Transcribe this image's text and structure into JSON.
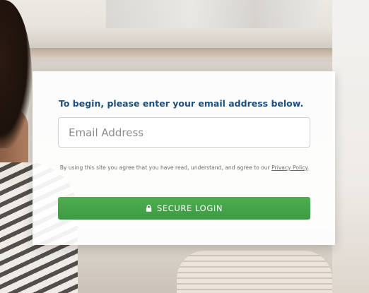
{
  "login": {
    "prompt": "To begin, please enter your email address below.",
    "email_placeholder": "Email Address",
    "email_value": "",
    "terms_text": "By using this site you agree that you have read, understand, and agree to our",
    "privacy_link": "Privacy Policy",
    "terms_end": ".",
    "button_label": "SECURE LOGIN",
    "button_icon": "lock-icon"
  },
  "colors": {
    "prompt_text": "#1c4f7d",
    "button_green": "#45a44b"
  }
}
